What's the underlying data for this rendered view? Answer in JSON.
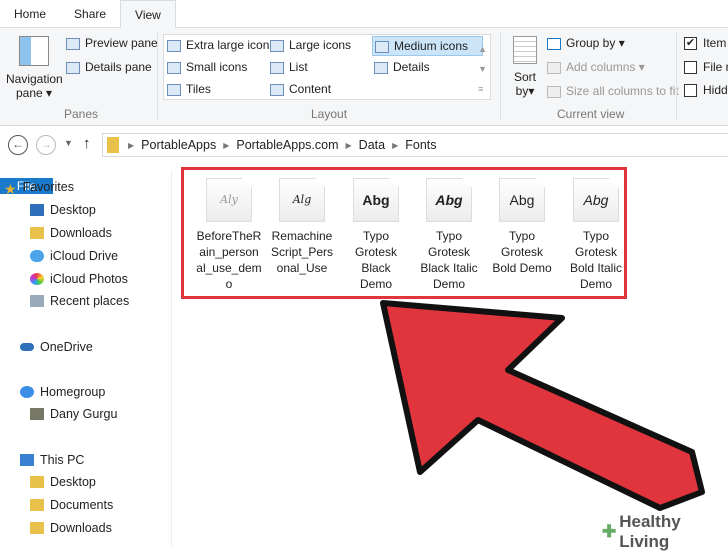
{
  "tabs": [
    "File",
    "Home",
    "Share",
    "View"
  ],
  "ribbon": {
    "panes": {
      "nav": "Navigation",
      "nav2": "pane",
      "preview": "Preview pane",
      "details": "Details pane",
      "group": "Panes"
    },
    "layout": {
      "items": [
        "Extra large icons",
        "Large icons",
        "Medium icons",
        "Small icons",
        "List",
        "Details",
        "Tiles",
        "Content"
      ],
      "selected": "Medium icons",
      "group": "Layout"
    },
    "current_view": {
      "sort": "Sort",
      "sort2": "by",
      "group_by": "Group by",
      "add_columns": "Add columns",
      "size_all": "Size all columns to fit",
      "group": "Current view"
    },
    "show_hide": {
      "items": [
        {
          "label": "Item",
          "checked": true
        },
        {
          "label": "File n",
          "checked": false
        },
        {
          "label": "Hidd",
          "checked": false
        }
      ]
    }
  },
  "address": {
    "crumbs": [
      "PortableApps",
      "PortableApps.com",
      "Data",
      "Fonts"
    ]
  },
  "sidebar": {
    "favorites": "Favorites",
    "fav_items": [
      "Desktop",
      "Downloads",
      "iCloud Drive",
      "iCloud Photos",
      "Recent places"
    ],
    "onedrive": "OneDrive",
    "homegroup": "Homegroup",
    "home_items": [
      "Dany Gurgu"
    ],
    "thispc": "This PC",
    "pc_items": [
      "Desktop",
      "Documents",
      "Downloads"
    ]
  },
  "files": [
    {
      "preview": "Aly",
      "lines": [
        "BeforeTheR",
        "ain_person",
        "al_use_dem",
        "o"
      ]
    },
    {
      "preview": "Alg",
      "lines": [
        "Remachine",
        "Script_Pers",
        "onal_Use"
      ]
    },
    {
      "preview": "Abg",
      "lines": [
        "Typo",
        "Grotesk",
        "Black",
        "Demo"
      ]
    },
    {
      "preview": "Abg",
      "lines": [
        "Typo",
        "Grotesk",
        "Black Italic",
        "Demo"
      ]
    },
    {
      "preview": "Abg",
      "lines": [
        "Typo",
        "Grotesk",
        "Bold Demo"
      ]
    },
    {
      "preview": "Abg",
      "lines": [
        "Typo",
        "Grotesk",
        "Bold Italic",
        "Demo"
      ]
    }
  ],
  "watermark": "Healthy Living",
  "colors": {
    "accent": "#1979ca",
    "highlight": "#e0353d"
  }
}
